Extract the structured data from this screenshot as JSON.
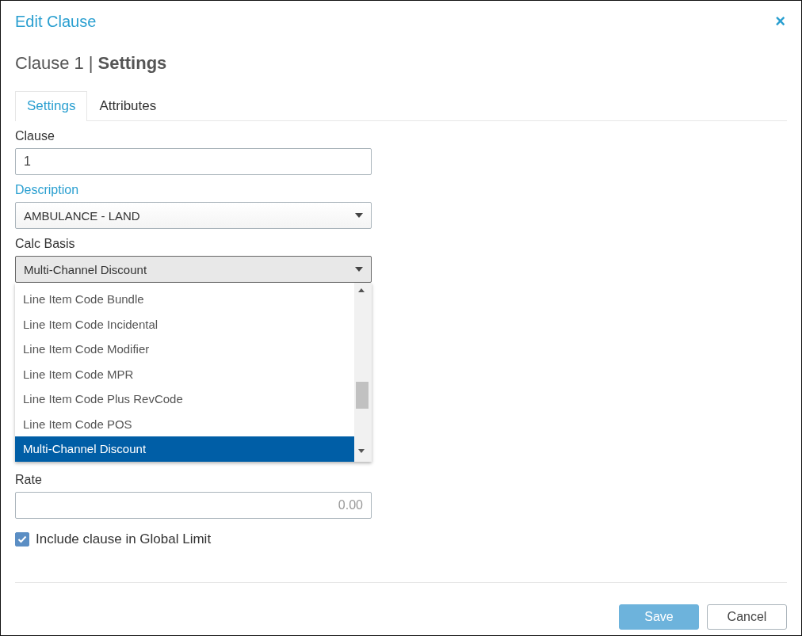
{
  "dialog": {
    "title": "Edit Clause",
    "close": "×"
  },
  "heading": {
    "name": "Clause 1",
    "separator": "|",
    "section": "Settings"
  },
  "tabs": [
    {
      "label": "Settings",
      "selected": true
    },
    {
      "label": "Attributes",
      "selected": false
    }
  ],
  "fields": [
    {
      "kind": "text",
      "label": "Clause",
      "value": "1",
      "highlighted": false
    },
    {
      "kind": "select",
      "label": "Description",
      "value": "AMBULANCE - LAND",
      "highlighted": true,
      "open": false
    },
    {
      "kind": "select",
      "label": "Calc Basis",
      "value": "Multi-Channel Discount",
      "highlighted": false,
      "open": true,
      "options": [
        {
          "label": "Line Item Code Bundle",
          "selected": false
        },
        {
          "label": "Line Item Code Incidental",
          "selected": false
        },
        {
          "label": "Line Item Code Modifier",
          "selected": false
        },
        {
          "label": "Line Item Code MPR",
          "selected": false
        },
        {
          "label": "Line Item Code Plus RevCode",
          "selected": false
        },
        {
          "label": "Line Item Code POS",
          "selected": false
        },
        {
          "label": "Multi-Channel Discount",
          "selected": true
        }
      ]
    },
    {
      "kind": "number",
      "label": "Rate",
      "placeholder": "0.00",
      "highlighted": false
    }
  ],
  "checkbox": {
    "label": "Include clause in Global Limit",
    "checked": true
  },
  "buttons": [
    {
      "label": "Save",
      "kind": "primary",
      "disabled": true
    },
    {
      "label": "Cancel",
      "kind": "secondary",
      "disabled": false
    }
  ]
}
